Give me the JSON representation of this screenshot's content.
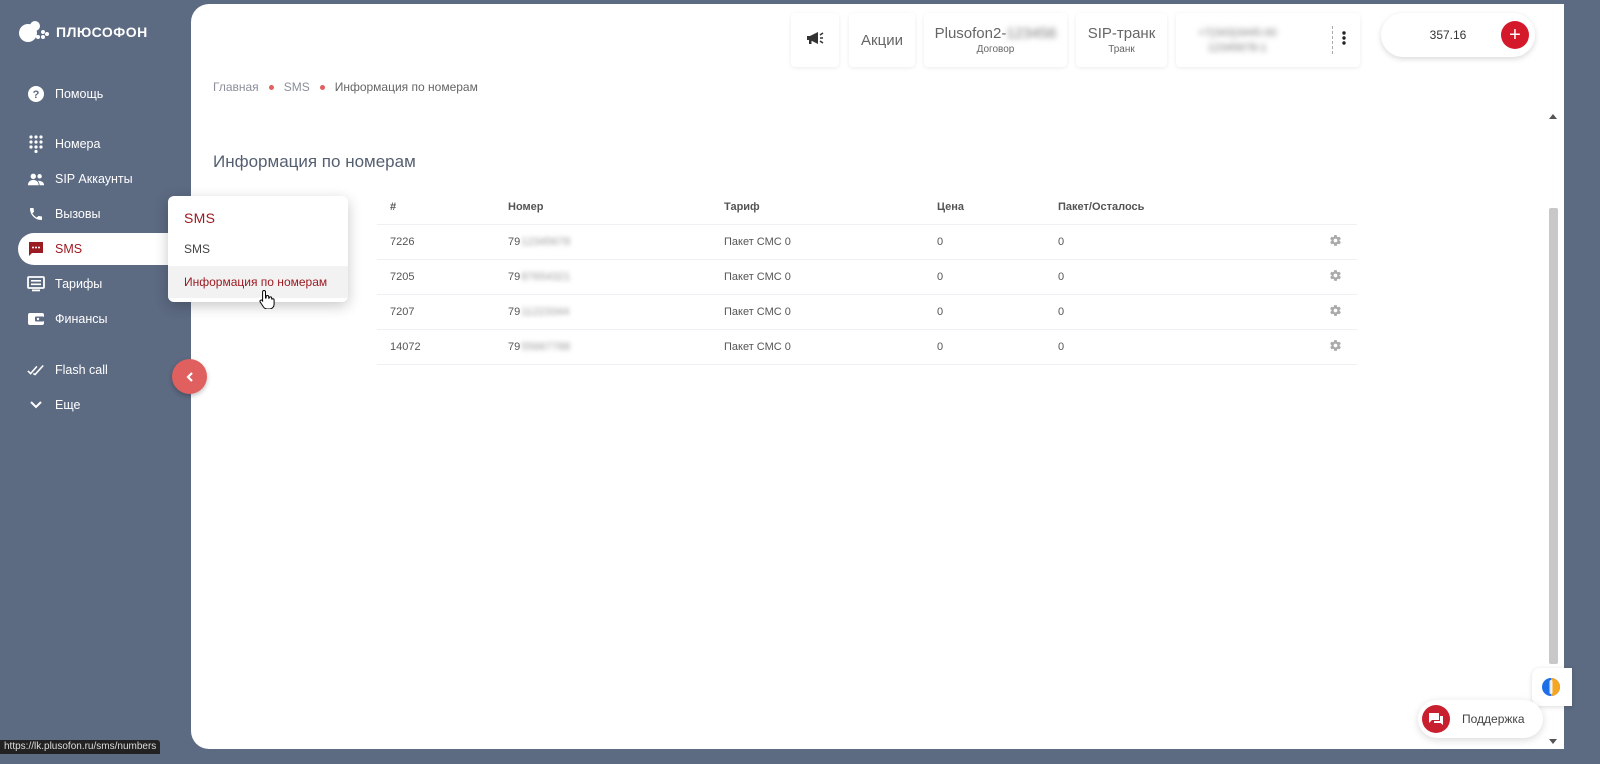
{
  "brand": {
    "name": "ПЛЮСОФОН",
    "accent": "#d4192b",
    "sidebar_bg": "#5c6a82"
  },
  "sidebar": {
    "items": [
      {
        "label": "Помощь",
        "icon": "help-circle-icon"
      },
      {
        "label": "Номера",
        "icon": "dialpad-icon"
      },
      {
        "label": "SIP Аккаунты",
        "icon": "users-icon"
      },
      {
        "label": "Вызовы",
        "icon": "phone-icon"
      },
      {
        "label": "SMS",
        "icon": "chat-icon",
        "active": true
      },
      {
        "label": "Тарифы",
        "icon": "list-icon"
      },
      {
        "label": "Финансы",
        "icon": "wallet-icon"
      },
      {
        "label": "Flash call",
        "icon": "double-check-icon"
      },
      {
        "label": "Еще",
        "icon": "chevron-down-icon"
      }
    ]
  },
  "header": {
    "promo_label": "Акции",
    "contract": {
      "value": "Plusofon2-",
      "value_hidden": "123456",
      "caption": "Договор"
    },
    "trunk": {
      "value": "SIP-транк",
      "caption": "Транк"
    },
    "phones": {
      "line1": "+7(343)3445-00",
      "line2": "12345678-1"
    },
    "balance": "357.16",
    "add_label": "+"
  },
  "breadcrumb": [
    "Главная",
    "SMS",
    "Информация по номерам"
  ],
  "page_title": "Информация по номерам",
  "table": {
    "columns": [
      "#",
      "Номер",
      "Тариф",
      "Цена",
      "Пакет/Осталось"
    ],
    "rows": [
      {
        "id": "7226",
        "prefix": "79",
        "hidden": "12345678",
        "tariff": "Пакет СМС 0",
        "price": "0",
        "package": "0"
      },
      {
        "id": "7205",
        "prefix": "79",
        "hidden": "87654321",
        "tariff": "Пакет СМС 0",
        "price": "0",
        "package": "0"
      },
      {
        "id": "7207",
        "prefix": "79",
        "hidden": "11223344",
        "tariff": "Пакет СМС 0",
        "price": "0",
        "package": "0"
      },
      {
        "id": "14072",
        "prefix": "79",
        "hidden": "55667788",
        "tariff": "Пакет СМС 0",
        "price": "0",
        "package": "0"
      }
    ]
  },
  "dropdown": {
    "title": "SMS",
    "items": [
      "SMS",
      "Информация по номерам"
    ]
  },
  "support_label": "Поддержка",
  "status_url": "https://lk.plusofon.ru/sms/numbers"
}
